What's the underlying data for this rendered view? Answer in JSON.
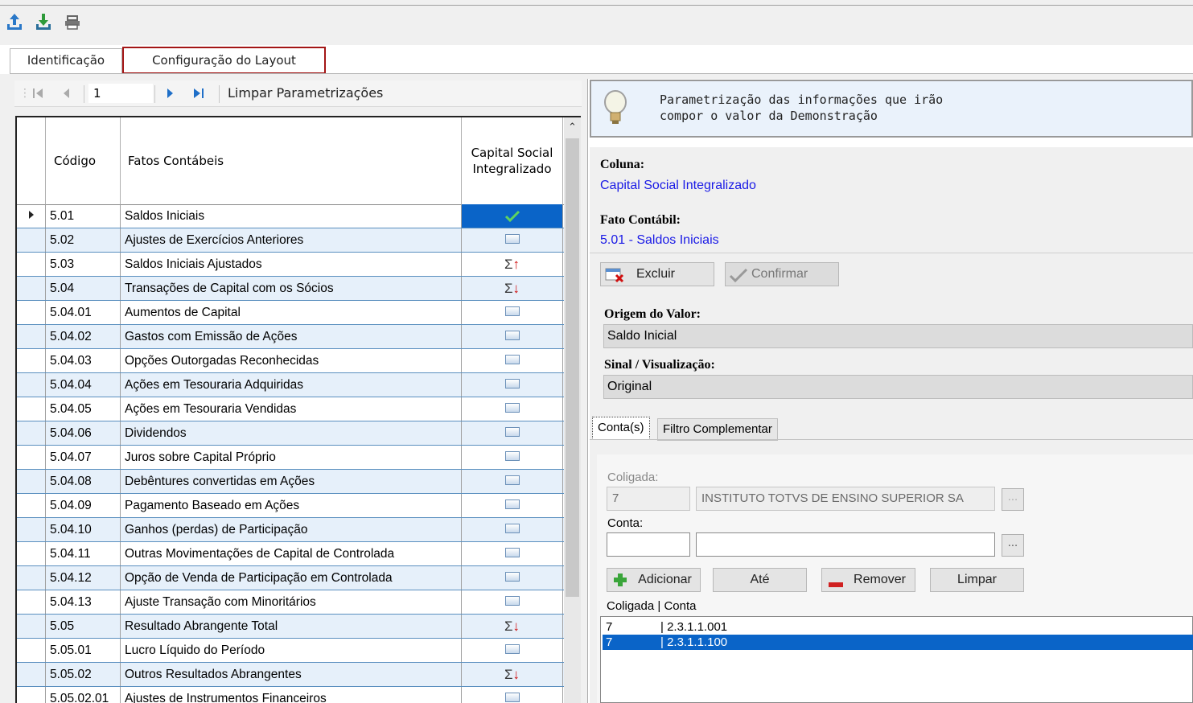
{
  "toolbar": {
    "icons": [
      "upload-icon",
      "download-icon",
      "print-icon"
    ]
  },
  "tabs": [
    "Identificação",
    "Configuração do Layout"
  ],
  "nav": {
    "record": "1",
    "clear_label": "Limpar Parametrizações"
  },
  "grid": {
    "headers": [
      "Código",
      "Fatos Contábeis",
      "Capital Social\nIntegralizado"
    ],
    "header_cap1": "Capital Social",
    "header_cap2": "Integralizado",
    "rows": [
      {
        "code": "5.01",
        "name": "Saldos Iniciais",
        "icon": "check"
      },
      {
        "code": "5.02",
        "name": "Ajustes de Exercícios Anteriores",
        "icon": "box"
      },
      {
        "code": "5.03",
        "name": "Saldos Iniciais Ajustados",
        "icon": "sum-up"
      },
      {
        "code": "5.04",
        "name": "Transações de Capital com os Sócios",
        "icon": "sum-down"
      },
      {
        "code": "5.04.01",
        "name": "Aumentos de Capital",
        "icon": "box"
      },
      {
        "code": "5.04.02",
        "name": "Gastos com Emissão de Ações",
        "icon": "box"
      },
      {
        "code": "5.04.03",
        "name": "Opções Outorgadas Reconhecidas",
        "icon": "box"
      },
      {
        "code": "5.04.04",
        "name": "Ações em Tesouraria Adquiridas",
        "icon": "box"
      },
      {
        "code": "5.04.05",
        "name": "Ações em Tesouraria Vendidas",
        "icon": "box"
      },
      {
        "code": "5.04.06",
        "name": "Dividendos",
        "icon": "box"
      },
      {
        "code": "5.04.07",
        "name": "Juros sobre Capital Próprio",
        "icon": "box"
      },
      {
        "code": "5.04.08",
        "name": "Debêntures convertidas em Ações",
        "icon": "box"
      },
      {
        "code": "5.04.09",
        "name": "Pagamento Baseado em Ações",
        "icon": "box"
      },
      {
        "code": "5.04.10",
        "name": "Ganhos (perdas) de Participação",
        "icon": "box"
      },
      {
        "code": "5.04.11",
        "name": "Outras Movimentações de Capital de Controlada",
        "icon": "box"
      },
      {
        "code": "5.04.12",
        "name": "Opção de Venda de Participação em Controlada",
        "icon": "box"
      },
      {
        "code": "5.04.13",
        "name": "Ajuste Transação com Minoritários",
        "icon": "box"
      },
      {
        "code": "5.05",
        "name": "Resultado Abrangente Total",
        "icon": "sum-down"
      },
      {
        "code": "5.05.01",
        "name": "Lucro Líquido do Período",
        "icon": "box"
      },
      {
        "code": "5.05.02",
        "name": "Outros Resultados Abrangentes",
        "icon": "sum-down"
      },
      {
        "code": "5.05.02.01",
        "name": "Ajustes de Instrumentos Financeiros",
        "icon": "box"
      }
    ]
  },
  "hint": {
    "line1": "Parametrização das informações que irão",
    "line2": "compor o valor da Demonstração"
  },
  "detail": {
    "coluna_label": "Coluna:",
    "coluna_value": "Capital Social Integralizado",
    "fato_label": "Fato Contábil:",
    "fato_value": "5.01 - Saldos Iniciais",
    "excluir": "Excluir",
    "confirmar": "Confirmar",
    "origem_label": "Origem do Valor:",
    "origem_value": "Saldo Inicial",
    "sinal_label": "Sinal / Visualização:",
    "sinal_value": "Original"
  },
  "subtabs": [
    "Conta(s)",
    "Filtro Complementar"
  ],
  "contas": {
    "coligada_label": "Coligada:",
    "coligada_code": "7",
    "coligada_name": "INSTITUTO TOTVS DE ENSINO SUPERIOR SA",
    "conta_label": "Conta:",
    "dots": "...",
    "btn_add": "Adicionar",
    "btn_ate": "Até",
    "btn_remove": "Remover",
    "btn_clear": "Limpar",
    "list_header": "Coligada | Conta",
    "list": [
      {
        "coligada": "7",
        "conta": "| 2.3.1.1.001"
      },
      {
        "coligada": "7",
        "conta": "| 2.3.1.1.100"
      }
    ]
  },
  "colors": {
    "selection": "#0a64c8",
    "link_blue": "#1a1ae6",
    "tab_highlight": "#a31515",
    "row_alt": "#e6f0fa"
  }
}
